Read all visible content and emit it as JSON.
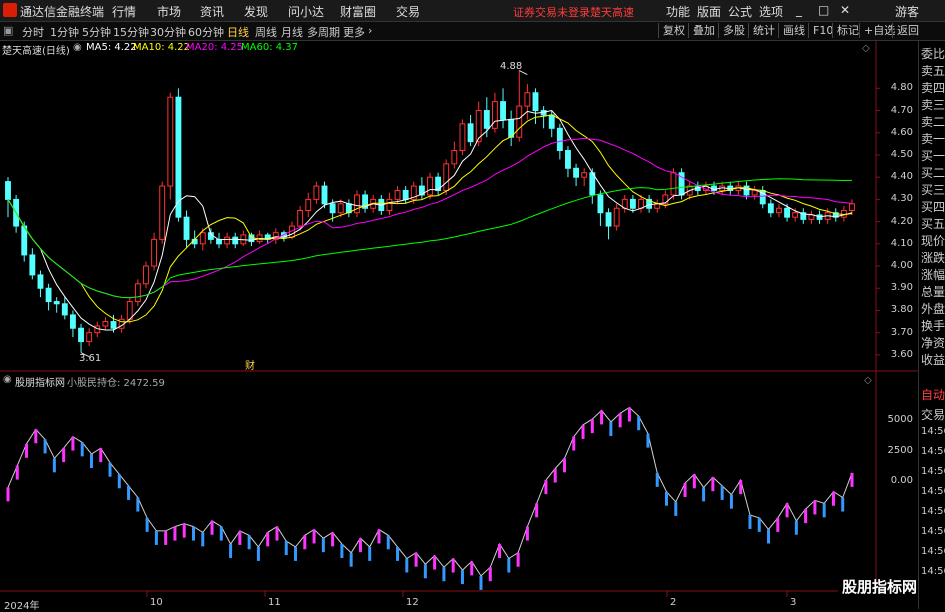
{
  "menubar": {
    "app_title": "通达信金融终端",
    "items": [
      "行情",
      "市场",
      "资讯",
      "发现",
      "问小达",
      "财富圈",
      "交易"
    ],
    "warning": "证券交易未登录",
    "stock_name": "楚天高速",
    "right_items": [
      "功能",
      "版面",
      "公式",
      "选项"
    ],
    "window_controls": [
      "_",
      "□",
      "✕"
    ],
    "user": "游客"
  },
  "toolbar": {
    "periods": [
      "分时",
      "1分钟",
      "5分钟",
      "15分钟",
      "30分钟",
      "60分钟",
      "日线",
      "周线",
      "月线",
      "多周期",
      "更多"
    ],
    "active_period": "日线",
    "right_buttons": [
      "复权",
      "叠加",
      "多股",
      "统计",
      "画线",
      "F10",
      "标记",
      "+自选",
      "返回"
    ]
  },
  "chart_legend": {
    "title": "楚天高速(日线)",
    "ma5": "MA5: 4.22",
    "ma10": "MA10: 4.22",
    "ma20": "MA20: 4.25",
    "ma60": "MA60: 4.37",
    "colors": {
      "ma5": "#ffffff",
      "ma10": "#ffff00",
      "ma20": "#ff00ff",
      "ma60": "#00ff00"
    }
  },
  "price_axis": [
    "4.80",
    "4.70",
    "4.60",
    "4.50",
    "4.40",
    "4.30",
    "4.20",
    "4.10",
    "4.00",
    "3.90",
    "3.80",
    "3.70",
    "3.60"
  ],
  "high_label": "4.88",
  "low_label": "3.61",
  "event_marker": "财",
  "indicator_legend": {
    "name": "股朋指标网",
    "series": "小股民持仓: 2472.59"
  },
  "indicator_axis": [
    "5000",
    "2500",
    "0.00"
  ],
  "time_axis": [
    "2024年",
    "10",
    "11",
    "12",
    "2",
    "3"
  ],
  "right_panel": {
    "items": [
      "委比",
      "卖五",
      "卖四",
      "卖三",
      "卖二",
      "卖一",
      "买一",
      "买二",
      "买三",
      "买四",
      "买五",
      "现价",
      "涨跌",
      "涨幅",
      "总量",
      "外盘",
      "换手",
      "净资",
      "收益"
    ],
    "bottom_items": [
      "自动",
      "交易",
      "14:56",
      "14:56",
      "14:56",
      "14:56",
      "14:56",
      "14:56",
      "14:56",
      "14:56"
    ]
  },
  "watermark": "股朋指标网",
  "chart_data": {
    "type": "candlestick",
    "title": "楚天高速(日线)",
    "ylim": [
      3.55,
      4.95
    ],
    "up_color": "#ff3232",
    "down_color": "#54ffff",
    "candles": [
      [
        4.38,
        4.3,
        4.4,
        4.22
      ],
      [
        4.3,
        4.18,
        4.32,
        4.15
      ],
      [
        4.18,
        4.05,
        4.2,
        4.02
      ],
      [
        4.05,
        3.96,
        4.08,
        3.94
      ],
      [
        3.96,
        3.9,
        3.98,
        3.86
      ],
      [
        3.9,
        3.84,
        3.92,
        3.8
      ],
      [
        3.84,
        3.83,
        3.86,
        3.79
      ],
      [
        3.83,
        3.78,
        3.86,
        3.76
      ],
      [
        3.78,
        3.72,
        3.8,
        3.68
      ],
      [
        3.72,
        3.66,
        3.74,
        3.61
      ],
      [
        3.66,
        3.7,
        3.72,
        3.64
      ],
      [
        3.7,
        3.73,
        3.75,
        3.68
      ],
      [
        3.73,
        3.75,
        3.77,
        3.71
      ],
      [
        3.75,
        3.72,
        3.78,
        3.7
      ],
      [
        3.72,
        3.76,
        3.78,
        3.7
      ],
      [
        3.76,
        3.84,
        3.86,
        3.74
      ],
      [
        3.84,
        3.92,
        3.94,
        3.82
      ],
      [
        3.92,
        4.0,
        4.02,
        3.9
      ],
      [
        4.0,
        4.12,
        4.15,
        3.98
      ],
      [
        4.12,
        4.36,
        4.38,
        4.1
      ],
      [
        4.36,
        4.76,
        4.78,
        4.3
      ],
      [
        4.76,
        4.22,
        4.8,
        4.2
      ],
      [
        4.22,
        4.12,
        4.25,
        4.08
      ],
      [
        4.12,
        4.1,
        4.16,
        4.08
      ],
      [
        4.1,
        4.15,
        4.17,
        4.07
      ],
      [
        4.15,
        4.12,
        4.17,
        4.1
      ],
      [
        4.12,
        4.1,
        4.15,
        4.08
      ],
      [
        4.1,
        4.13,
        4.15,
        4.08
      ],
      [
        4.13,
        4.1,
        4.15,
        4.08
      ],
      [
        4.1,
        4.14,
        4.16,
        4.09
      ],
      [
        4.14,
        4.11,
        4.15,
        4.09
      ],
      [
        4.11,
        4.14,
        4.16,
        4.1
      ],
      [
        4.14,
        4.12,
        4.15,
        4.1
      ],
      [
        4.12,
        4.15,
        4.17,
        4.1
      ],
      [
        4.15,
        4.13,
        4.16,
        4.11
      ],
      [
        4.13,
        4.18,
        4.2,
        4.12
      ],
      [
        4.18,
        4.25,
        4.27,
        4.16
      ],
      [
        4.25,
        4.3,
        4.33,
        4.22
      ],
      [
        4.3,
        4.36,
        4.38,
        4.28
      ],
      [
        4.36,
        4.28,
        4.38,
        4.26
      ],
      [
        4.28,
        4.24,
        4.3,
        4.2
      ],
      [
        4.24,
        4.28,
        4.3,
        4.22
      ],
      [
        4.28,
        4.24,
        4.3,
        4.22
      ],
      [
        4.24,
        4.32,
        4.34,
        4.22
      ],
      [
        4.32,
        4.26,
        4.34,
        4.24
      ],
      [
        4.26,
        4.3,
        4.32,
        4.24
      ],
      [
        4.3,
        4.25,
        4.32,
        4.23
      ],
      [
        4.25,
        4.3,
        4.33,
        4.23
      ],
      [
        4.3,
        4.34,
        4.36,
        4.28
      ],
      [
        4.34,
        4.3,
        4.36,
        4.28
      ],
      [
        4.3,
        4.36,
        4.38,
        4.28
      ],
      [
        4.36,
        4.32,
        4.4,
        4.3
      ],
      [
        4.32,
        4.4,
        4.42,
        4.3
      ],
      [
        4.4,
        4.34,
        4.42,
        4.32
      ],
      [
        4.34,
        4.46,
        4.48,
        4.32
      ],
      [
        4.46,
        4.52,
        4.56,
        4.44
      ],
      [
        4.52,
        4.64,
        4.66,
        4.5
      ],
      [
        4.64,
        4.56,
        4.68,
        4.54
      ],
      [
        4.56,
        4.7,
        4.74,
        4.54
      ],
      [
        4.7,
        4.62,
        4.76,
        4.58
      ],
      [
        4.62,
        4.74,
        4.78,
        4.6
      ],
      [
        4.74,
        4.66,
        4.8,
        4.62
      ],
      [
        4.66,
        4.58,
        4.7,
        4.54
      ],
      [
        4.58,
        4.72,
        4.88,
        4.56
      ],
      [
        4.72,
        4.78,
        4.82,
        4.66
      ],
      [
        4.78,
        4.7,
        4.8,
        4.64
      ],
      [
        4.7,
        4.68,
        4.72,
        4.62
      ],
      [
        4.68,
        4.62,
        4.7,
        4.58
      ],
      [
        4.62,
        4.52,
        4.64,
        4.48
      ],
      [
        4.52,
        4.44,
        4.54,
        4.4
      ],
      [
        4.44,
        4.4,
        4.46,
        4.36
      ],
      [
        4.4,
        4.42,
        4.44,
        4.36
      ],
      [
        4.42,
        4.32,
        4.44,
        4.28
      ],
      [
        4.32,
        4.24,
        4.34,
        4.18
      ],
      [
        4.24,
        4.18,
        4.26,
        4.12
      ],
      [
        4.18,
        4.26,
        4.28,
        4.16
      ],
      [
        4.26,
        4.3,
        4.32,
        4.24
      ],
      [
        4.3,
        4.26,
        4.32,
        4.24
      ],
      [
        4.26,
        4.3,
        4.32,
        4.24
      ],
      [
        4.3,
        4.26,
        4.32,
        4.24
      ],
      [
        4.26,
        4.28,
        4.3,
        4.24
      ],
      [
        4.28,
        4.32,
        4.34,
        4.26
      ],
      [
        4.32,
        4.42,
        4.44,
        4.3
      ],
      [
        4.42,
        4.32,
        4.44,
        4.3
      ],
      [
        4.32,
        4.36,
        4.38,
        4.3
      ],
      [
        4.36,
        4.34,
        4.38,
        4.32
      ],
      [
        4.34,
        4.36,
        4.38,
        4.32
      ],
      [
        4.36,
        4.34,
        4.38,
        4.32
      ],
      [
        4.34,
        4.36,
        4.38,
        4.32
      ],
      [
        4.36,
        4.34,
        4.38,
        4.32
      ],
      [
        4.34,
        4.36,
        4.38,
        4.32
      ],
      [
        4.36,
        4.32,
        4.38,
        4.3
      ],
      [
        4.32,
        4.34,
        4.36,
        4.3
      ],
      [
        4.34,
        4.28,
        4.36,
        4.26
      ],
      [
        4.28,
        4.24,
        4.3,
        4.22
      ],
      [
        4.24,
        4.26,
        4.28,
        4.22
      ],
      [
        4.26,
        4.22,
        4.28,
        4.2
      ],
      [
        4.22,
        4.24,
        4.26,
        4.2
      ],
      [
        4.24,
        4.21,
        4.26,
        4.19
      ],
      [
        4.21,
        4.23,
        4.25,
        4.19
      ],
      [
        4.23,
        4.21,
        4.25,
        4.19
      ],
      [
        4.21,
        4.24,
        4.26,
        4.19
      ],
      [
        4.24,
        4.22,
        4.26,
        4.2
      ],
      [
        4.22,
        4.25,
        4.27,
        4.2
      ],
      [
        4.25,
        4.28,
        4.3,
        4.23
      ]
    ],
    "indicator": [
      1500,
      3000,
      4500,
      5500,
      4800,
      3500,
      4200,
      5000,
      4600,
      3800,
      4200,
      3200,
      2400,
      1600,
      800,
      -600,
      -1500,
      -1500,
      -1200,
      -1000,
      -1200,
      -1600,
      -800,
      -1200,
      -2400,
      -1500,
      -1800,
      -2600,
      -1600,
      -1200,
      -2200,
      -2600,
      -1800,
      -1400,
      -2000,
      -1600,
      -2400,
      -3000,
      -2000,
      -2600,
      -1400,
      -1800,
      -2600,
      -3400,
      -3000,
      -3800,
      -3200,
      -4000,
      -3400,
      -4200,
      -3600,
      -4600,
      -4000,
      -2400,
      -3400,
      -3000,
      -1200,
      400,
      2000,
      2800,
      3500,
      5000,
      5800,
      6200,
      6800,
      6000,
      6600,
      7000,
      6400,
      5200,
      2500,
      1200,
      500,
      1800,
      2400,
      1500,
      2200,
      1600,
      1000,
      2000,
      -400,
      -600,
      -1400,
      -600,
      400,
      -800,
      0,
      600,
      400,
      1200,
      800,
      2500
    ],
    "ind_ylim": [
      -5500,
      8000
    ]
  }
}
